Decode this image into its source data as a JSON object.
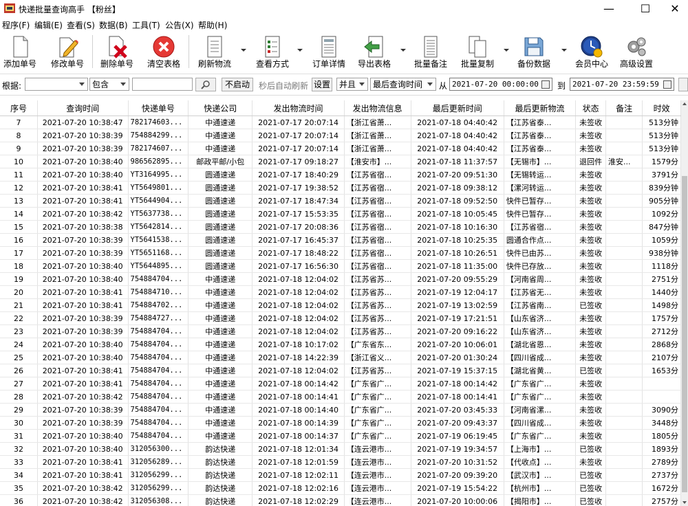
{
  "window": {
    "title": "快递批量查询高手 【粉丝】",
    "min": "—",
    "max": "☐",
    "close": "✕"
  },
  "menu": [
    "程序(F)",
    "编辑(E)",
    "查看(S)",
    "数据(B)",
    "工具(T)",
    "公告(X)",
    "帮助(H)"
  ],
  "toolbar": [
    {
      "label": "添加单号",
      "icon": "document-add-icon"
    },
    {
      "label": "修改单号",
      "icon": "pencil-edit-icon"
    },
    {
      "label": "删除单号",
      "icon": "document-delete-icon"
    },
    {
      "label": "清空表格",
      "icon": "red-x-clear-icon"
    },
    {
      "label": "刷新物流",
      "icon": "refresh-list-icon"
    },
    {
      "label": "查看方式",
      "icon": "view-list-icon"
    },
    {
      "label": "订单详情",
      "icon": "order-detail-icon"
    },
    {
      "label": "导出表格",
      "icon": "export-arrow-icon"
    },
    {
      "label": "批量备注",
      "icon": "note-icon"
    },
    {
      "label": "批量复制",
      "icon": "copy-icon"
    },
    {
      "label": "备份数据",
      "icon": "floppy-save-icon"
    },
    {
      "label": "会员中心",
      "icon": "clock-member-icon"
    },
    {
      "label": "高级设置",
      "icon": "gears-icon"
    }
  ],
  "filter": {
    "by_label": "根据:",
    "field_value": "",
    "match_mode": "包含",
    "search_value": "",
    "no_auto_btn": "不启动",
    "auto_refresh_text": "秒后自动刷新",
    "settings_btn": "设置",
    "logic": "并且",
    "date_field": "最后查询时间",
    "from_label": "从",
    "from_date": "2021-07-20 00:00:00",
    "to_label": "到",
    "to_date": "2021-07-20 23:59:59"
  },
  "table": {
    "columns": [
      "序号",
      "查询时间",
      "快递单号",
      "快递公司",
      "发出物流时间",
      "发出物流信息",
      "最后更新时间",
      "最后更新物流",
      "状态",
      "备注",
      "时效"
    ],
    "rows": [
      [
        "7",
        "2021-07-20 10:38:47",
        "782174603...",
        "中通速递",
        "2021-07-17 20:07:14",
        "【浙江省萧...",
        "2021-07-18 04:40:42",
        "【江苏省泰...",
        "未签收",
        "",
        "513分钟"
      ],
      [
        "8",
        "2021-07-20 10:38:39",
        "754884299...",
        "中通速递",
        "2021-07-17 20:07:14",
        "【浙江省萧...",
        "2021-07-18 04:40:42",
        "【江苏省泰...",
        "未签收",
        "",
        "513分钟"
      ],
      [
        "9",
        "2021-07-20 10:38:39",
        "782174607...",
        "中通速递",
        "2021-07-17 20:07:14",
        "【浙江省萧...",
        "2021-07-18 04:40:42",
        "【江苏省泰...",
        "未签收",
        "",
        "513分钟"
      ],
      [
        "10",
        "2021-07-20 10:38:40",
        "986562895...",
        "邮政平邮/小包",
        "2021-07-17 09:18:27",
        "【淮安市】...",
        "2021-07-18 11:37:57",
        "【无锡市】...",
        "退回件",
        "淮安...",
        "1579分"
      ],
      [
        "11",
        "2021-07-20 10:38:40",
        "YT3164995...",
        "圆通速递",
        "2021-07-17 18:40:29",
        "【江苏省宿...",
        "2021-07-20 09:51:30",
        "【无锡转运...",
        "未签收",
        "",
        "3791分"
      ],
      [
        "12",
        "2021-07-20 10:38:41",
        "YT5649801...",
        "圆通速递",
        "2021-07-17 19:38:52",
        "【江苏省宿...",
        "2021-07-18 09:38:12",
        "【漯河转运...",
        "未签收",
        "",
        "839分钟"
      ],
      [
        "13",
        "2021-07-20 10:38:41",
        "YT5644904...",
        "圆通速递",
        "2021-07-17 18:47:34",
        "【江苏省宿...",
        "2021-07-18 09:52:50",
        "快件已暂存...",
        "未签收",
        "",
        "905分钟"
      ],
      [
        "14",
        "2021-07-20 10:38:42",
        "YT5637738...",
        "圆通速递",
        "2021-07-17 15:53:35",
        "【江苏省宿...",
        "2021-07-18 10:05:45",
        "快件已暂存...",
        "未签收",
        "",
        "1092分"
      ],
      [
        "15",
        "2021-07-20 10:38:38",
        "YT5642814...",
        "圆通速递",
        "2021-07-17 20:08:36",
        "【江苏省宿...",
        "2021-07-18 10:16:30",
        "【江苏省宿...",
        "未签收",
        "",
        "847分钟"
      ],
      [
        "16",
        "2021-07-20 10:38:39",
        "YT5641538...",
        "圆通速递",
        "2021-07-17 16:45:37",
        "【江苏省宿...",
        "2021-07-18 10:25:35",
        "圆通合作点...",
        "未签收",
        "",
        "1059分"
      ],
      [
        "17",
        "2021-07-20 10:38:39",
        "YT5651168...",
        "圆通速递",
        "2021-07-17 18:48:22",
        "【江苏省宿...",
        "2021-07-18 10:26:51",
        "快件已由苏...",
        "未签收",
        "",
        "938分钟"
      ],
      [
        "18",
        "2021-07-20 10:38:40",
        "YT5644895...",
        "圆通速递",
        "2021-07-17 16:56:30",
        "【江苏省宿...",
        "2021-07-18 11:35:00",
        "快件已存放...",
        "未签收",
        "",
        "1118分"
      ],
      [
        "19",
        "2021-07-20 10:38:40",
        "754884704...",
        "中通速递",
        "2021-07-18 12:04:02",
        "【江苏省苏...",
        "2021-07-20 09:55:29",
        "【河南省周...",
        "未签收",
        "",
        "2751分"
      ],
      [
        "20",
        "2021-07-20 10:38:41",
        "754884710...",
        "中通速递",
        "2021-07-18 12:04:02",
        "【江苏省苏...",
        "2021-07-19 12:04:17",
        "【江苏省无...",
        "未签收",
        "",
        "1440分"
      ],
      [
        "21",
        "2021-07-20 10:38:41",
        "754884702...",
        "中通速递",
        "2021-07-18 12:04:02",
        "【江苏省苏...",
        "2021-07-19 13:02:59",
        "【江苏省南...",
        "已签收",
        "",
        "1498分"
      ],
      [
        "22",
        "2021-07-20 10:38:39",
        "754884727...",
        "中通速递",
        "2021-07-18 12:04:02",
        "【江苏省苏...",
        "2021-07-19 17:21:51",
        "【山东省济...",
        "未签收",
        "",
        "1757分"
      ],
      [
        "23",
        "2021-07-20 10:38:39",
        "754884704...",
        "中通速递",
        "2021-07-18 12:04:02",
        "【江苏省苏...",
        "2021-07-20 09:16:22",
        "【山东省济...",
        "未签收",
        "",
        "2712分"
      ],
      [
        "24",
        "2021-07-20 10:38:40",
        "754884704...",
        "中通速递",
        "2021-07-18 10:17:02",
        "【广东省东...",
        "2021-07-20 10:06:01",
        "【湖北省恩...",
        "未签收",
        "",
        "2868分"
      ],
      [
        "25",
        "2021-07-20 10:38:40",
        "754884704...",
        "中通速递",
        "2021-07-18 14:22:39",
        "【浙江省义...",
        "2021-07-20 01:30:24",
        "【四川省成...",
        "未签收",
        "",
        "2107分"
      ],
      [
        "26",
        "2021-07-20 10:38:41",
        "754884704...",
        "中通速递",
        "2021-07-18 12:04:02",
        "【江苏省苏...",
        "2021-07-19 15:37:15",
        "【湖北省黄...",
        "已签收",
        "",
        "1653分"
      ],
      [
        "27",
        "2021-07-20 10:38:41",
        "754884704...",
        "中通速递",
        "2021-07-18 00:14:42",
        "【广东省广...",
        "2021-07-18 00:14:42",
        "【广东省广...",
        "未签收",
        "",
        ""
      ],
      [
        "28",
        "2021-07-20 10:38:42",
        "754884704...",
        "中通速递",
        "2021-07-18 00:14:41",
        "【广东省广...",
        "2021-07-18 00:14:41",
        "【广东省广...",
        "未签收",
        "",
        ""
      ],
      [
        "29",
        "2021-07-20 10:38:39",
        "754884704...",
        "中通速递",
        "2021-07-18 00:14:40",
        "【广东省广...",
        "2021-07-20 03:45:33",
        "【河南省漯...",
        "未签收",
        "",
        "3090分"
      ],
      [
        "30",
        "2021-07-20 10:38:39",
        "754884704...",
        "中通速递",
        "2021-07-18 00:14:39",
        "【广东省广...",
        "2021-07-20 09:43:37",
        "【四川省成...",
        "未签收",
        "",
        "3448分"
      ],
      [
        "31",
        "2021-07-20 10:38:40",
        "754884704...",
        "中通速递",
        "2021-07-18 00:14:37",
        "【广东省广...",
        "2021-07-19 06:19:45",
        "【广东省广...",
        "未签收",
        "",
        "1805分"
      ],
      [
        "32",
        "2021-07-20 10:38:40",
        "312056300...",
        "韵达快递",
        "2021-07-18 12:01:34",
        "【连云港市...",
        "2021-07-19 19:34:57",
        "【上海市】...",
        "已签收",
        "",
        "1893分"
      ],
      [
        "33",
        "2021-07-20 10:38:41",
        "312056289...",
        "韵达快递",
        "2021-07-18 12:01:59",
        "【连云港市...",
        "2021-07-20 10:31:52",
        "【代收点】...",
        "未签收",
        "",
        "2789分"
      ],
      [
        "34",
        "2021-07-20 10:38:41",
        "312056299...",
        "韵达快递",
        "2021-07-18 12:02:11",
        "【连云港市...",
        "2021-07-20 09:39:20",
        "【武汉市】...",
        "已签收",
        "",
        "2737分"
      ],
      [
        "35",
        "2021-07-20 10:38:42",
        "312056299...",
        "韵达快递",
        "2021-07-18 12:02:16",
        "【连云港市...",
        "2021-07-19 15:54:22",
        "【杭州市】...",
        "已签收",
        "",
        "1672分"
      ],
      [
        "36",
        "2021-07-20 10:38:42",
        "312056308...",
        "韵达快递",
        "2021-07-18 12:02:29",
        "【连云港市...",
        "2021-07-20 10:00:06",
        "【揭阳市】...",
        "已签收",
        "",
        "2757分"
      ]
    ]
  }
}
